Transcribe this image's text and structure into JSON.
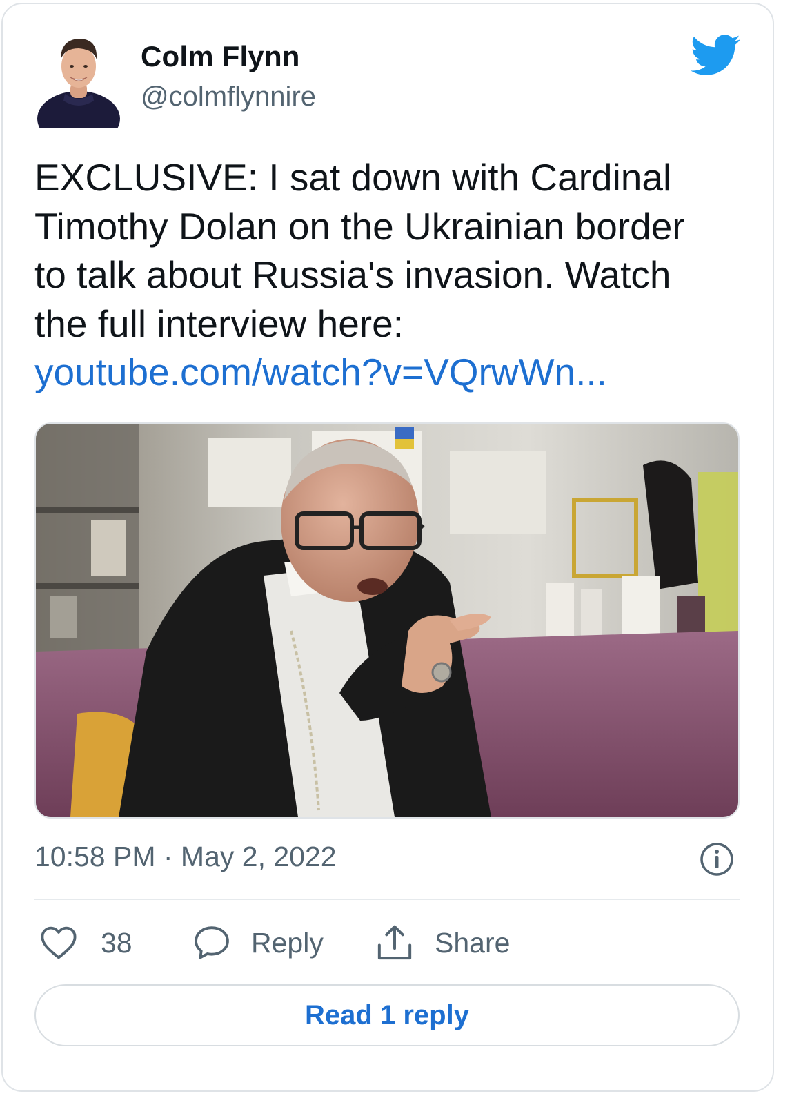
{
  "author": {
    "name": "Colm Flynn",
    "handle": "@colmflynnire",
    "avatar_icon": "profile-photo"
  },
  "brand": {
    "icon": "twitter-bird-icon",
    "color": "#1d9bf0"
  },
  "tweet": {
    "text_lines": [
      "EXCLUSIVE: I sat down with Cardinal",
      "Timothy Dolan on the Ukrainian border",
      "to talk about Russia's invasion. Watch",
      "the full interview here:"
    ],
    "link": "youtube.com/watch?v=VQrwWn...",
    "link_color": "#1d6fd1",
    "media_icon": "video-thumbnail-interview-photo",
    "timestamp": "10:58 PM · May 2, 2022"
  },
  "actions": {
    "like_count": "38",
    "reply_label": "Reply",
    "share_label": "Share"
  },
  "read_reply_label": "Read 1 reply",
  "colors": {
    "text_primary": "#0f1419",
    "text_secondary": "#536471",
    "border": "#dfe3e7"
  }
}
